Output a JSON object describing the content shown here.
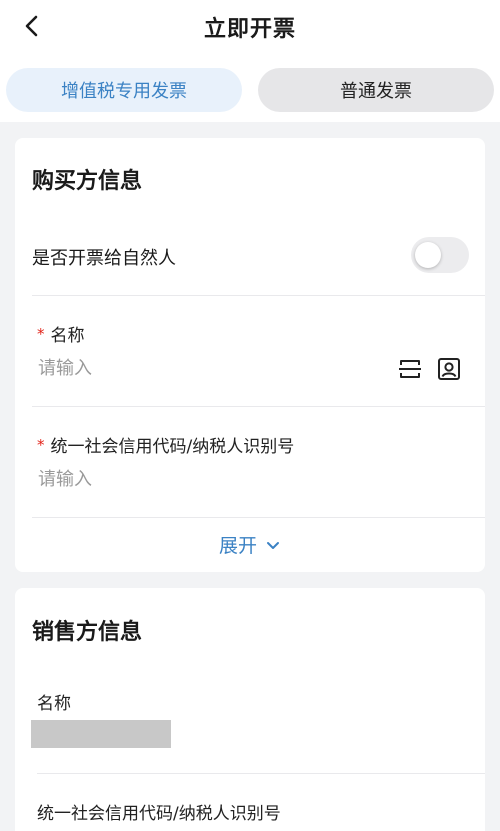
{
  "header": {
    "title": "立即开票"
  },
  "tabs": [
    {
      "label": "增值税专用发票",
      "active": true
    },
    {
      "label": "普通发票",
      "active": false
    }
  ],
  "buyer": {
    "title": "购买方信息",
    "natural_person_label": "是否开票给自然人",
    "natural_person_enabled": false,
    "name_field": {
      "required_mark": "*",
      "label": "名称",
      "value": "",
      "placeholder": "请输入"
    },
    "tax_id_field": {
      "required_mark": "*",
      "label": "统一社会信用代码/纳税人识别号",
      "value": "",
      "placeholder": "请输入"
    },
    "expand_label": "展开"
  },
  "seller": {
    "title": "销售方信息",
    "name_label": "名称",
    "tax_id_label": "统一社会信用代码/纳税人识别号"
  },
  "colors": {
    "accent": "#3b82c4",
    "active_tab_bg": "#e8f1fb",
    "inactive_tab_bg": "#e6e6e8",
    "required": "#e2231a",
    "page_bg": "#f2f3f5"
  },
  "icons": {
    "back": "chevron-left-icon",
    "scan": "scan-icon",
    "contact": "contact-card-icon",
    "expand": "chevron-down-icon"
  }
}
